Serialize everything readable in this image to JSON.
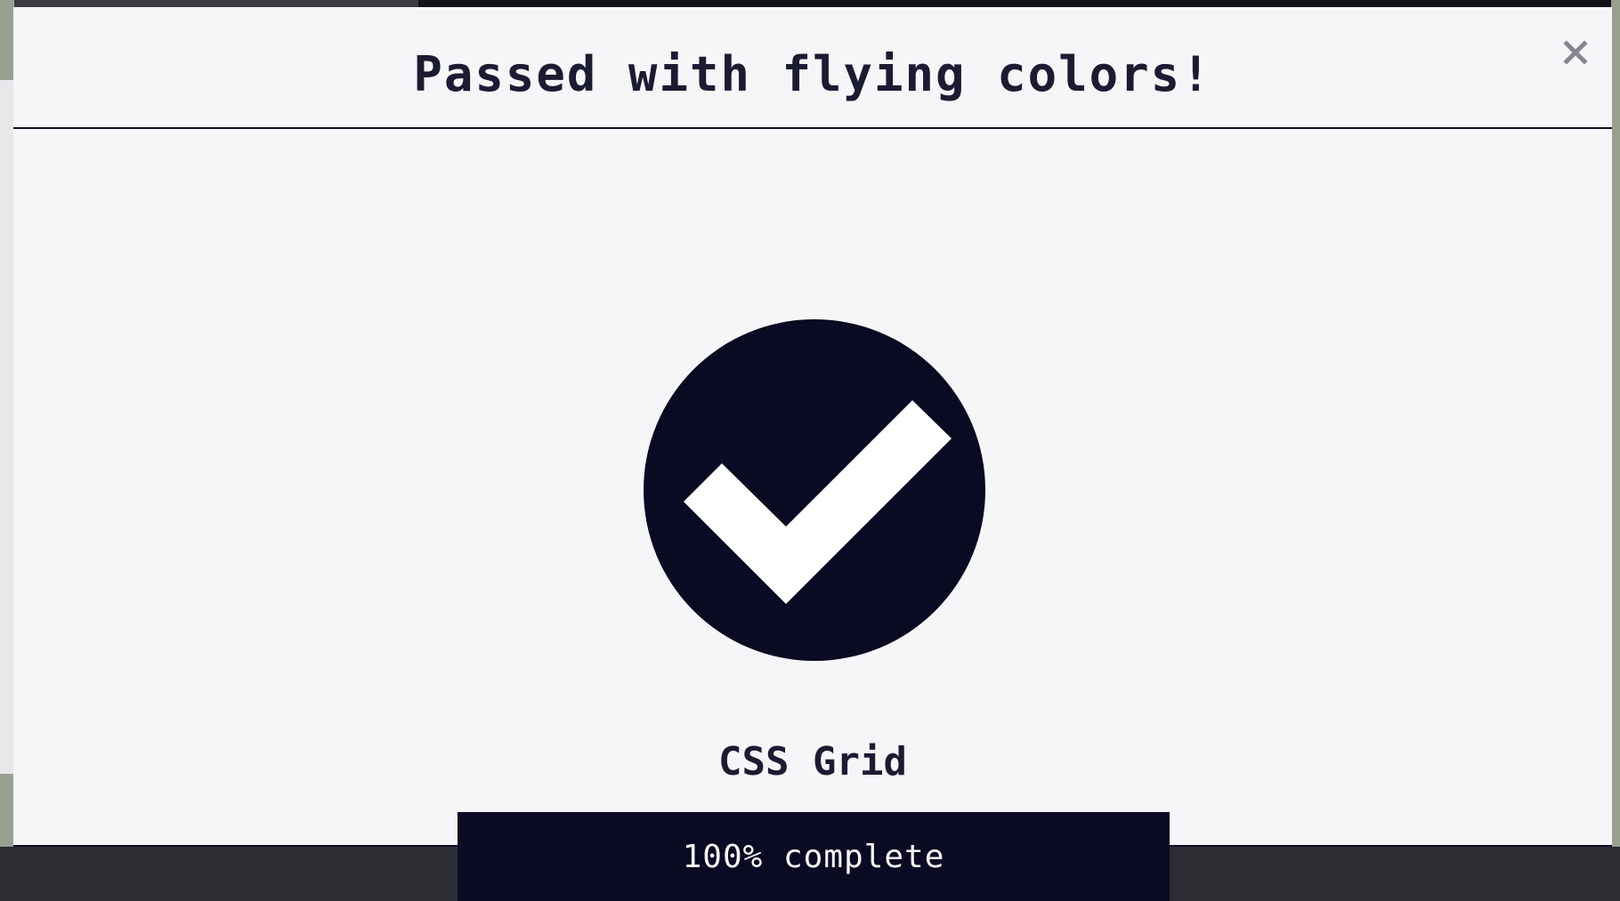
{
  "modal": {
    "title": "Passed with flying colors!",
    "close_label": "×"
  },
  "course": {
    "name": "CSS Grid"
  },
  "progress": {
    "percent": 100,
    "label": "100% complete"
  },
  "colors": {
    "primary_dark": "#0a0a23",
    "text_dark": "#1b1b32",
    "modal_bg": "#f4f6f8",
    "close_icon": "#858591"
  },
  "icons": {
    "badge": "check-circle-icon",
    "close": "close-icon"
  }
}
